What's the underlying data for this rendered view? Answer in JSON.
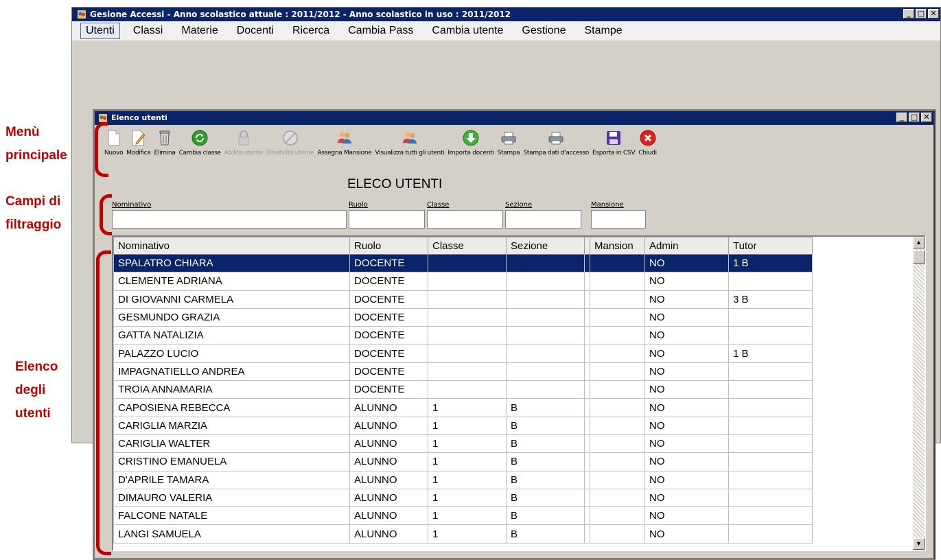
{
  "annotations": {
    "menu": [
      "Menù",
      "principale"
    ],
    "filters": [
      "Campi di",
      "filtraggio"
    ],
    "list": [
      "Elenco",
      "degli",
      "utenti"
    ]
  },
  "app": {
    "title": "Gesione Accessi - Anno scolastico attuale : 2011/2012 - Anno scolastico in uso : 2011/2012",
    "menu": [
      "Utenti",
      "Classi",
      "Materie",
      "Docenti",
      "Ricerca",
      "Cambia Pass",
      "Cambia utente",
      "Gestione",
      "Stampe"
    ]
  },
  "child": {
    "title": "Elenco utenti",
    "toolbar": [
      {
        "label": "Nuovo",
        "icon": "new-document-icon",
        "enabled": true
      },
      {
        "label": "Modifica",
        "icon": "edit-document-icon",
        "enabled": true
      },
      {
        "label": "Elimina",
        "icon": "trash-icon",
        "enabled": true
      },
      {
        "label": "Cambia classe",
        "icon": "refresh-icon",
        "enabled": true
      },
      {
        "label": "Abilita utente",
        "icon": "lock-icon",
        "enabled": false
      },
      {
        "label": "Disabilita utente",
        "icon": "disable-icon",
        "enabled": false
      },
      {
        "label": "Assegna Mansione",
        "icon": "users-icon",
        "enabled": true
      },
      {
        "label": "Visualizza tutti gli utenti",
        "icon": "users-icon",
        "enabled": true
      },
      {
        "label": "Importa docenti",
        "icon": "import-icon",
        "enabled": true
      },
      {
        "label": "Stampa",
        "icon": "printer-icon",
        "enabled": true
      },
      {
        "label": "Stampa dati d'accesso",
        "icon": "printer-icon",
        "enabled": true
      },
      {
        "label": "Esporta in CSV",
        "icon": "floppy-icon",
        "enabled": true
      },
      {
        "label": "Chiudi",
        "icon": "close-icon",
        "enabled": true
      }
    ],
    "heading": "ELECO UTENTI",
    "filters": {
      "nominativo": {
        "label": "Nominativo",
        "value": ""
      },
      "ruolo": {
        "label": "Ruolo",
        "value": ""
      },
      "classe": {
        "label": "Classe",
        "value": ""
      },
      "sezione": {
        "label": "Sezione",
        "value": ""
      },
      "mansione": {
        "label": "Mansione",
        "value": ""
      }
    },
    "columns": [
      "Nominativo",
      "Ruolo",
      "Classe",
      "Sezione",
      "",
      "Mansion",
      "Admin",
      "Tutor"
    ],
    "rows": [
      [
        "SPALATRO CHIARA",
        "DOCENTE",
        "",
        "",
        "",
        "",
        "NO",
        "1 B"
      ],
      [
        "CLEMENTE ADRIANA",
        "DOCENTE",
        "",
        "",
        "",
        "",
        "NO",
        ""
      ],
      [
        "DI GIOVANNI CARMELA",
        "DOCENTE",
        "",
        "",
        "",
        "",
        "NO",
        "3 B"
      ],
      [
        "GESMUNDO GRAZIA",
        "DOCENTE",
        "",
        "",
        "",
        "",
        "NO",
        ""
      ],
      [
        "GATTA NATALIZIA",
        "DOCENTE",
        "",
        "",
        "",
        "",
        "NO",
        ""
      ],
      [
        "PALAZZO LUCIO",
        "DOCENTE",
        "",
        "",
        "",
        "",
        "NO",
        "1 B"
      ],
      [
        "IMPAGNATIELLO ANDREA",
        "DOCENTE",
        "",
        "",
        "",
        "",
        "NO",
        ""
      ],
      [
        "TROIA ANNAMARIA",
        "DOCENTE",
        "",
        "",
        "",
        "",
        "NO",
        ""
      ],
      [
        "CAPOSIENA REBECCA",
        "ALUNNO",
        "1",
        "B",
        "",
        "",
        "NO",
        ""
      ],
      [
        "CARIGLIA MARZIA",
        "ALUNNO",
        "1",
        "B",
        "",
        "",
        "NO",
        ""
      ],
      [
        "CARIGLIA WALTER",
        "ALUNNO",
        "1",
        "B",
        "",
        "",
        "NO",
        ""
      ],
      [
        "CRISTINO EMANUELA",
        "ALUNNO",
        "1",
        "B",
        "",
        "",
        "NO",
        ""
      ],
      [
        "D'APRILE TAMARA",
        "ALUNNO",
        "1",
        "B",
        "",
        "",
        "NO",
        ""
      ],
      [
        "DIMAURO VALERIA",
        "ALUNNO",
        "1",
        "B",
        "",
        "",
        "NO",
        ""
      ],
      [
        "FALCONE NATALE",
        "ALUNNO",
        "1",
        "B",
        "",
        "",
        "NO",
        ""
      ],
      [
        "LANGI SAMUELA",
        "ALUNNO",
        "1",
        "B",
        "",
        "",
        "NO",
        ""
      ]
    ],
    "selected_row": 0
  },
  "colors": {
    "titlebar": "#0a246a",
    "selection": "#0a246a",
    "annotation": "#c00000",
    "window_bg": "#d4d0c8"
  }
}
